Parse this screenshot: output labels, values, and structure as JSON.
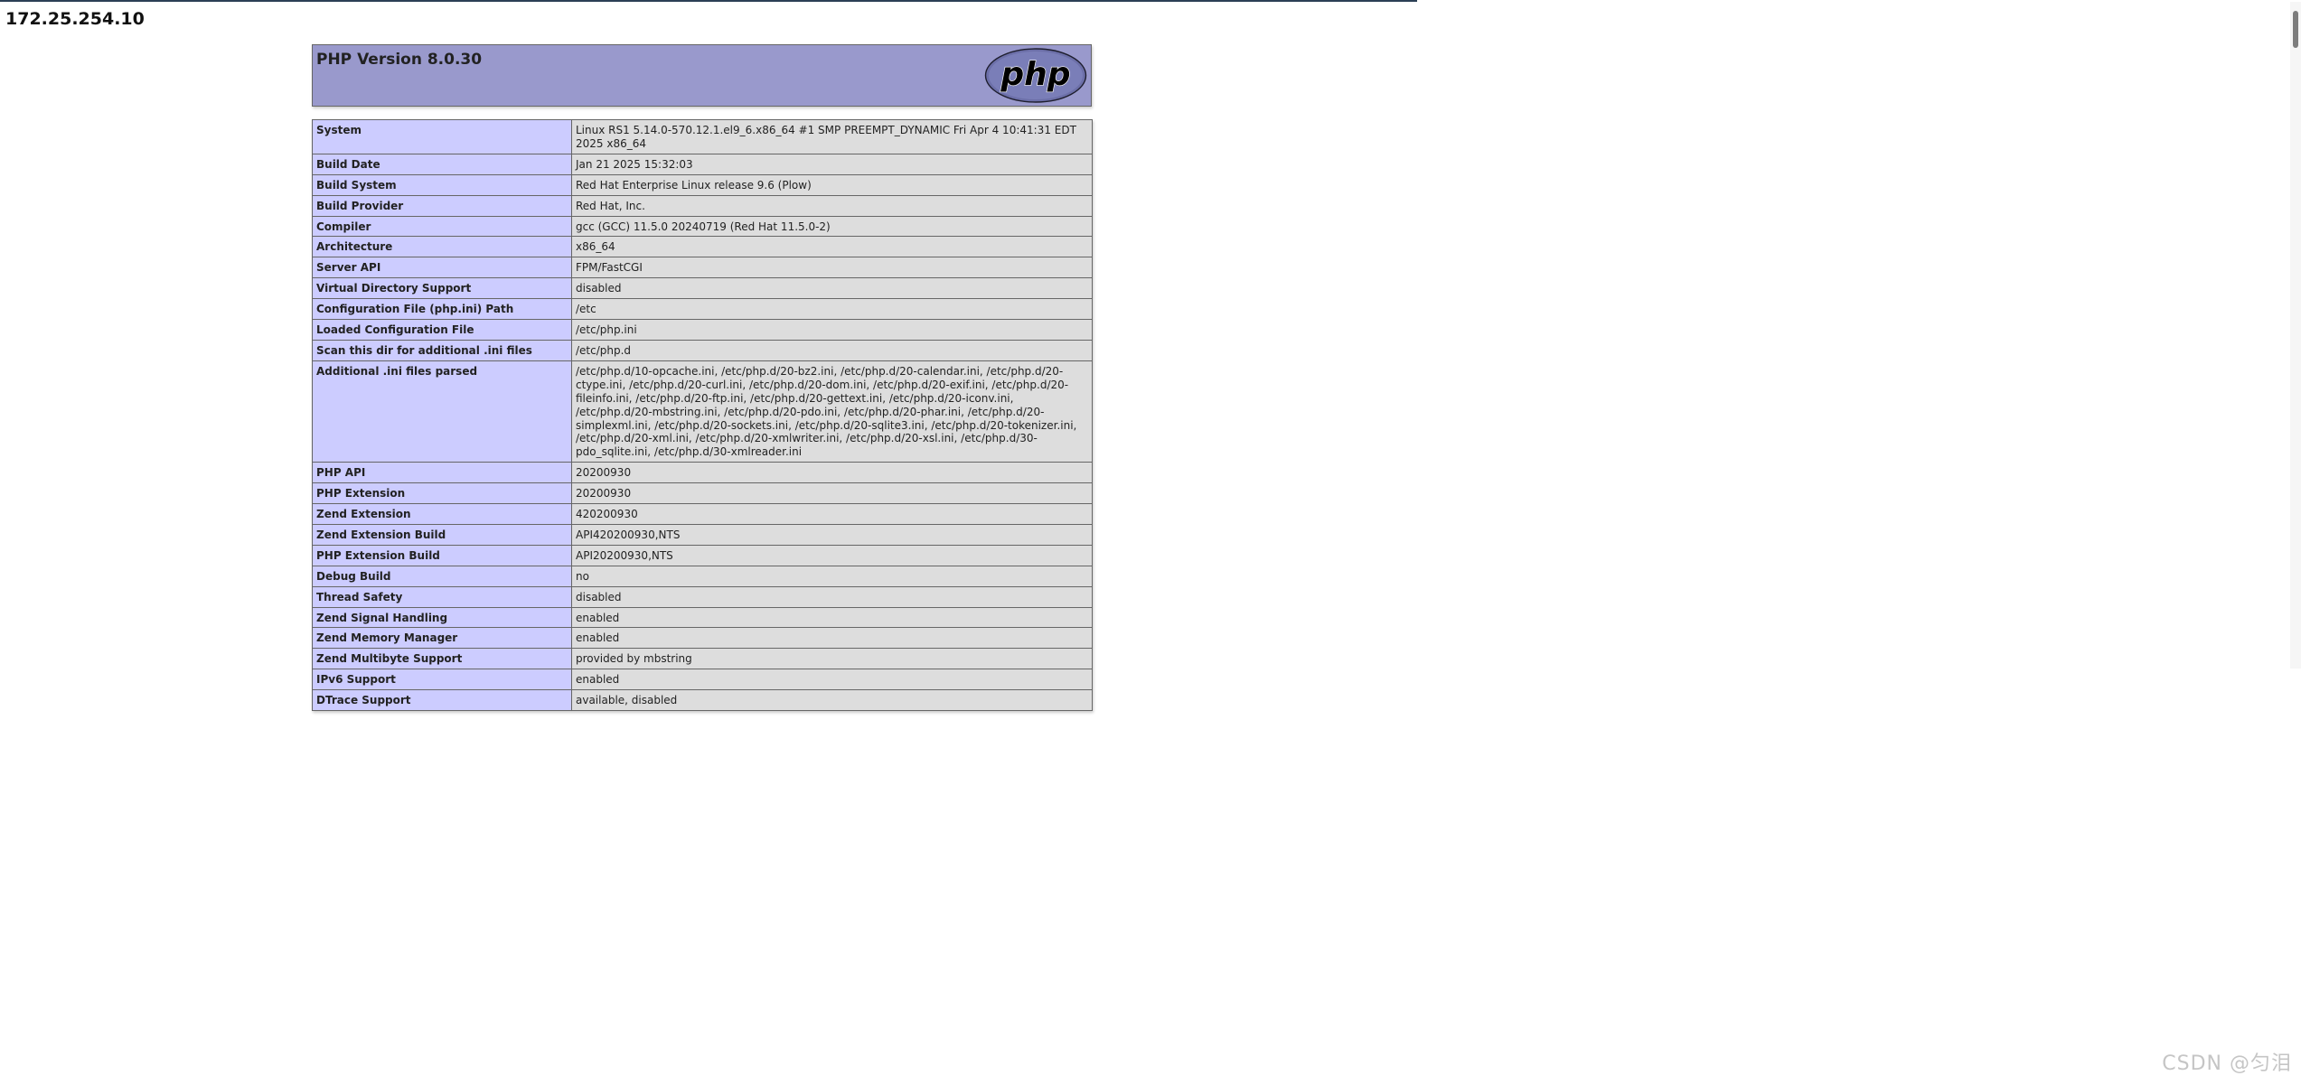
{
  "page": {
    "host_title": "172.25.254.10",
    "watermark": "CSDN @匀泪"
  },
  "header": {
    "version_title": "PHP Version 8.0.30",
    "logo_text": "php"
  },
  "info_rows": [
    {
      "key": "System",
      "value": "Linux RS1 5.14.0-570.12.1.el9_6.x86_64 #1 SMP PREEMPT_DYNAMIC Fri Apr 4 10:41:31 EDT 2025 x86_64"
    },
    {
      "key": "Build Date",
      "value": "Jan 21 2025 15:32:03"
    },
    {
      "key": "Build System",
      "value": "Red Hat Enterprise Linux release 9.6 (Plow)"
    },
    {
      "key": "Build Provider",
      "value": "Red Hat, Inc."
    },
    {
      "key": "Compiler",
      "value": "gcc (GCC) 11.5.0 20240719 (Red Hat 11.5.0-2)"
    },
    {
      "key": "Architecture",
      "value": "x86_64"
    },
    {
      "key": "Server API",
      "value": "FPM/FastCGI"
    },
    {
      "key": "Virtual Directory Support",
      "value": "disabled"
    },
    {
      "key": "Configuration File (php.ini) Path",
      "value": "/etc"
    },
    {
      "key": "Loaded Configuration File",
      "value": "/etc/php.ini"
    },
    {
      "key": "Scan this dir for additional .ini files",
      "value": "/etc/php.d"
    },
    {
      "key": "Additional .ini files parsed",
      "value": "/etc/php.d/10-opcache.ini, /etc/php.d/20-bz2.ini, /etc/php.d/20-calendar.ini, /etc/php.d/20-ctype.ini, /etc/php.d/20-curl.ini, /etc/php.d/20-dom.ini, /etc/php.d/20-exif.ini, /etc/php.d/20-fileinfo.ini, /etc/php.d/20-ftp.ini, /etc/php.d/20-gettext.ini, /etc/php.d/20-iconv.ini, /etc/php.d/20-mbstring.ini, /etc/php.d/20-pdo.ini, /etc/php.d/20-phar.ini, /etc/php.d/20-simplexml.ini, /etc/php.d/20-sockets.ini, /etc/php.d/20-sqlite3.ini, /etc/php.d/20-tokenizer.ini, /etc/php.d/20-xml.ini, /etc/php.d/20-xmlwriter.ini, /etc/php.d/20-xsl.ini, /etc/php.d/30-pdo_sqlite.ini, /etc/php.d/30-xmlreader.ini"
    },
    {
      "key": "PHP API",
      "value": "20200930"
    },
    {
      "key": "PHP Extension",
      "value": "20200930"
    },
    {
      "key": "Zend Extension",
      "value": "420200930"
    },
    {
      "key": "Zend Extension Build",
      "value": "API420200930,NTS"
    },
    {
      "key": "PHP Extension Build",
      "value": "API20200930,NTS"
    },
    {
      "key": "Debug Build",
      "value": "no"
    },
    {
      "key": "Thread Safety",
      "value": "disabled"
    },
    {
      "key": "Zend Signal Handling",
      "value": "enabled"
    },
    {
      "key": "Zend Memory Manager",
      "value": "enabled"
    },
    {
      "key": "Zend Multibyte Support",
      "value": "provided by mbstring"
    },
    {
      "key": "IPv6 Support",
      "value": "enabled"
    },
    {
      "key": "DTrace Support",
      "value": "available, disabled"
    }
  ],
  "colors": {
    "header_bg": "#9999cc",
    "key_cell_bg": "#ccccff",
    "value_cell_bg": "#dddddd",
    "border": "#666666"
  }
}
